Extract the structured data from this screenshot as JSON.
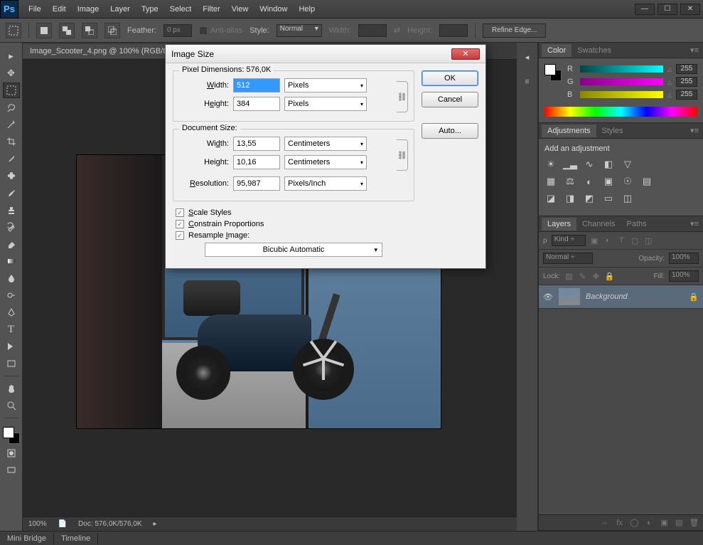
{
  "app": {
    "logo": "Ps"
  },
  "menu": [
    "File",
    "Edit",
    "Image",
    "Layer",
    "Type",
    "Select",
    "Filter",
    "View",
    "Window",
    "Help"
  ],
  "options": {
    "feather_label": "Feather:",
    "feather": "0 px",
    "anti_alias": "Anti-alias",
    "style_label": "Style:",
    "style": "Normal",
    "width_label": "Width:",
    "height_label": "Height:",
    "refine": "Refine Edge..."
  },
  "doc": {
    "tab": "Image_Scooter_4.png @ 100% (RGB/8)",
    "zoom": "100%",
    "doc_info": "Doc: 576,0K/576,0K"
  },
  "dialog": {
    "title": "Image Size",
    "px_dim_label": "Pixel Dimensions:",
    "px_dim_val": "576,0K",
    "width_label": "Width:",
    "height_label": "Height:",
    "px_width": "512",
    "px_height": "384",
    "px_unit": "Pixels",
    "doc_size_label": "Document Size:",
    "doc_width": "13,55",
    "doc_height": "10,16",
    "doc_unit": "Centimeters",
    "res_label": "Resolution:",
    "res_val": "95,987",
    "res_unit": "Pixels/Inch",
    "scale_styles": "Scale Styles",
    "constrain": "Constrain Proportions",
    "resample": "Resample Image:",
    "resample_method": "Bicubic Automatic",
    "ok": "OK",
    "cancel": "Cancel",
    "auto": "Auto..."
  },
  "panels": {
    "color_tab": "Color",
    "swatches_tab": "Swatches",
    "r": "R",
    "g": "G",
    "b": "B",
    "val": "255",
    "adjustments_tab": "Adjustments",
    "styles_tab": "Styles",
    "adj_title": "Add an adjustment",
    "layers_tab": "Layers",
    "channels_tab": "Channels",
    "paths_tab": "Paths",
    "kind": "Kind",
    "blend": "Normal",
    "opacity_label": "Opacity:",
    "opacity": "100%",
    "lock_label": "Lock:",
    "fill_label": "Fill:",
    "fill": "100%",
    "layer_name": "Background"
  },
  "bottom": {
    "mini_bridge": "Mini Bridge",
    "timeline": "Timeline"
  }
}
